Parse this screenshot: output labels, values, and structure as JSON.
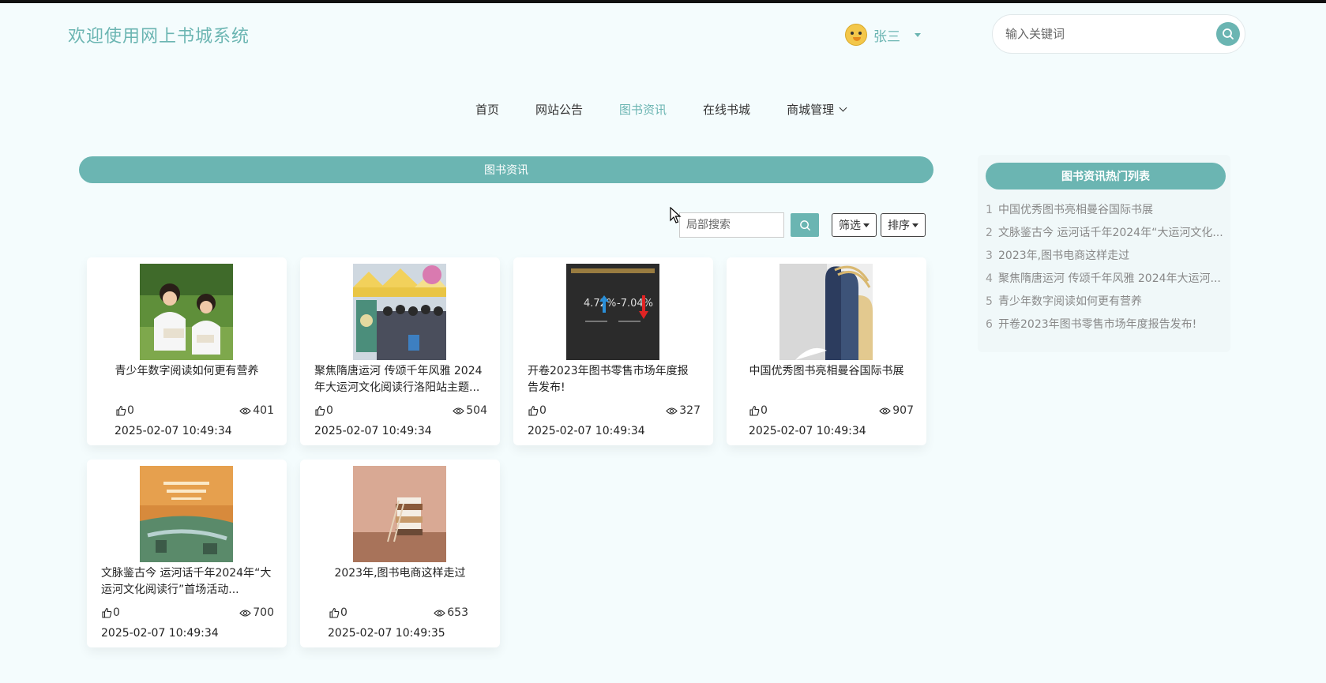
{
  "header": {
    "site_title": "欢迎使用网上书城系统",
    "user_name": "张三",
    "search_placeholder": "输入关键词"
  },
  "nav": {
    "items": [
      {
        "label": "首页",
        "active": false
      },
      {
        "label": "网站公告",
        "active": false
      },
      {
        "label": "图书资讯",
        "active": true
      },
      {
        "label": "在线书城",
        "active": false
      },
      {
        "label": "商城管理",
        "active": false,
        "has_dropdown": true
      }
    ]
  },
  "main": {
    "section_title": "图书资讯",
    "local_search_placeholder": "局部搜索",
    "filter_label": "筛选",
    "sort_label": "排序",
    "cards": [
      {
        "title": "青少年数字阅读如何更有营养",
        "likes": "0",
        "views": "401",
        "date": "2025-02-07 10:49:34"
      },
      {
        "title": "聚焦隋唐运河 传颂千年风雅 2024年大运河文化阅读行洛阳站主题...",
        "likes": "0",
        "views": "504",
        "date": "2025-02-07 10:49:34"
      },
      {
        "title": "开卷2023年图书零售市场年度报告发布!",
        "likes": "0",
        "views": "327",
        "date": "2025-02-07 10:49:34"
      },
      {
        "title": "中国优秀图书亮相曼谷国际书展",
        "likes": "0",
        "views": "907",
        "date": "2025-02-07 10:49:34"
      },
      {
        "title": "文脉鉴古今 运河话千年2024年“大运河文化阅读行”首场活动...",
        "likes": "0",
        "views": "700",
        "date": "2025-02-07 10:49:34"
      },
      {
        "title": "2023年,图书电商这样走过",
        "likes": "0",
        "views": "653",
        "date": "2025-02-07 10:49:35"
      }
    ]
  },
  "sidebar": {
    "title": "图书资讯热门列表",
    "items": [
      {
        "num": "1",
        "text": "中国优秀图书亮相曼谷国际书展"
      },
      {
        "num": "2",
        "text": "文脉鉴古今 运河话千年2024年“大运河文化..."
      },
      {
        "num": "3",
        "text": "2023年,图书电商这样走过"
      },
      {
        "num": "4",
        "text": "聚焦隋唐运河 传颂千年风雅 2024年大运河..."
      },
      {
        "num": "5",
        "text": "青少年数字阅读如何更有营养"
      },
      {
        "num": "6",
        "text": "开卷2023年图书零售市场年度报告发布!"
      }
    ]
  },
  "colors": {
    "accent": "#6bb5b2",
    "background": "#f4fcfd"
  }
}
